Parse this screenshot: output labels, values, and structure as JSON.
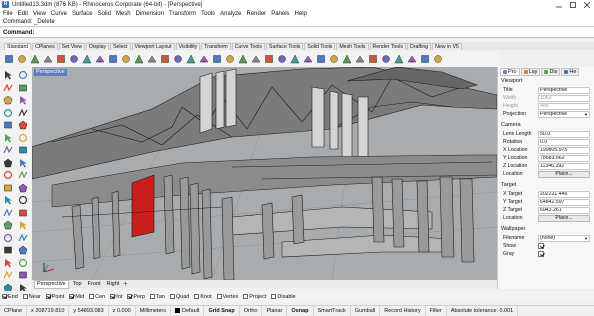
{
  "window": {
    "title": "Untitled13.3dm (876 KB) - Rhinoceros Corporate (64-bit) - [Perspective]",
    "logo_letter": "R"
  },
  "menu": [
    "File",
    "Edit",
    "View",
    "Curve",
    "Surface",
    "Solid",
    "Mesh",
    "Dimension",
    "Transform",
    "Tools",
    "Analyze",
    "Render",
    "Panels",
    "Help"
  ],
  "command": {
    "history": "Command: _Delete",
    "prompt": "Command:"
  },
  "toolbar_tabs": [
    {
      "label": "Standard",
      "active": true
    },
    {
      "label": "CPlanes"
    },
    {
      "label": "Set View"
    },
    {
      "label": "Display"
    },
    {
      "label": "Select"
    },
    {
      "label": "Viewport Layout"
    },
    {
      "label": "Visibility"
    },
    {
      "label": "Transform"
    },
    {
      "label": "Curve Tools"
    },
    {
      "label": "Surface Tools"
    },
    {
      "label": "Solid Tools"
    },
    {
      "label": "Mesh Tools"
    },
    {
      "label": "Render Tools"
    },
    {
      "label": "Drafting"
    },
    {
      "label": "New in V5"
    }
  ],
  "toolbar_icons": [
    "new-file",
    "open-file",
    "save-file",
    "print",
    "import",
    "cut",
    "copy",
    "paste",
    "undo",
    "redo",
    "pan",
    "rotate-view",
    "zoom",
    "zoom-window",
    "zoom-extents",
    "zoom-selected",
    "4-viewports",
    "grid",
    "shade",
    "render",
    "material",
    "layer",
    "properties",
    "light",
    "match",
    "analyze",
    "options",
    "help",
    "points",
    "lock",
    "extra",
    "extra2",
    "extra3",
    "extra4"
  ],
  "side_icons": [
    "select-arrow",
    "point",
    "curve",
    "polyline",
    "arc",
    "circle",
    "ellipse",
    "rectangle",
    "polygon",
    "freeform",
    "curve-fillet",
    "offset",
    "surface",
    "loft",
    "extrude",
    "box",
    "sphere",
    "cylinder",
    "boolean",
    "mesh",
    "join",
    "explode",
    "trim",
    "split",
    "move",
    "copy",
    "rotate",
    "scale",
    "mirror",
    "array",
    "text",
    "dimension",
    "block",
    "hatch",
    "distance",
    "angle"
  ],
  "viewport": {
    "label": "Perspective"
  },
  "viewport_tabs": [
    {
      "label": "Perspective",
      "active": true
    },
    {
      "label": "Top"
    },
    {
      "label": "Front"
    },
    {
      "label": "Right"
    }
  ],
  "viewport_add_symbol": "+",
  "osnaps": [
    {
      "label": "End",
      "checked": true
    },
    {
      "label": "Near",
      "checked": false
    },
    {
      "label": "Point",
      "checked": true
    },
    {
      "label": "Mid",
      "checked": true
    },
    {
      "label": "Cen",
      "checked": false
    },
    {
      "label": "Int",
      "checked": true
    },
    {
      "label": "Perp",
      "checked": true
    },
    {
      "label": "Tan",
      "checked": false
    },
    {
      "label": "Quad",
      "checked": false
    },
    {
      "label": "Knot",
      "checked": false
    },
    {
      "label": "Vertex",
      "checked": false
    },
    {
      "label": "Project",
      "checked": false
    },
    {
      "label": "Disable",
      "checked": false
    }
  ],
  "status": {
    "cplane": "CPlane",
    "x": "x 208719.810",
    "y": "y 54893.083",
    "z": "z 0.000",
    "units": "Millimeters",
    "layer": "Default",
    "grid_snap": "Grid Snap",
    "ortho": "Ortho",
    "planar": "Planar",
    "osnap": "Osnap",
    "smarttrack": "SmartTrack",
    "gumball": "Gumball",
    "record_history": "Record History",
    "filter": "Filter",
    "tolerance": "Absolute tolerance: 0.001"
  },
  "panel": {
    "tabs": [
      {
        "label": "Pro",
        "active": true,
        "color": "#6a8ac4"
      },
      {
        "label": "Lay",
        "color": "#c98b3a"
      },
      {
        "label": "Dis",
        "color": "#5aa05a"
      },
      {
        "label": "He",
        "color": "#3b78c8"
      }
    ],
    "viewport_section": "Viewport",
    "viewport_rows": [
      {
        "key": "Title",
        "value": "Perspective",
        "dim": false
      },
      {
        "key": "Width",
        "value": "1063",
        "dim": true
      },
      {
        "key": "Height",
        "value": "486",
        "dim": true
      },
      {
        "key": "Projection",
        "value": "Perspective",
        "dim": false,
        "dropdown": true
      }
    ],
    "camera_section": "Camera",
    "camera_rows": [
      {
        "key": "Lens Length",
        "value": "50.0"
      },
      {
        "key": "Rotation",
        "value": "0.0"
      },
      {
        "key": "X Location",
        "value": "199805.975"
      },
      {
        "key": "Y Location",
        "value": "78683.662"
      },
      {
        "key": "Z Location",
        "value": "11346.392"
      }
    ],
    "camera_location": {
      "key": "Location",
      "button": "Place..."
    },
    "target_section": "Target",
    "target_rows": [
      {
        "key": "X Target",
        "value": "202221.446"
      },
      {
        "key": "Y Target",
        "value": "64842.597"
      },
      {
        "key": "Z Target",
        "value": "6943.261"
      }
    ],
    "target_location": {
      "key": "Location",
      "button": "Place..."
    },
    "wallpaper_section": "Wallpaper",
    "wallpaper_filename": {
      "key": "Filename",
      "value": "(none)"
    },
    "wallpaper_show": {
      "key": "Show",
      "checked": true
    },
    "wallpaper_gray": {
      "key": "Gray",
      "checked": true
    }
  }
}
